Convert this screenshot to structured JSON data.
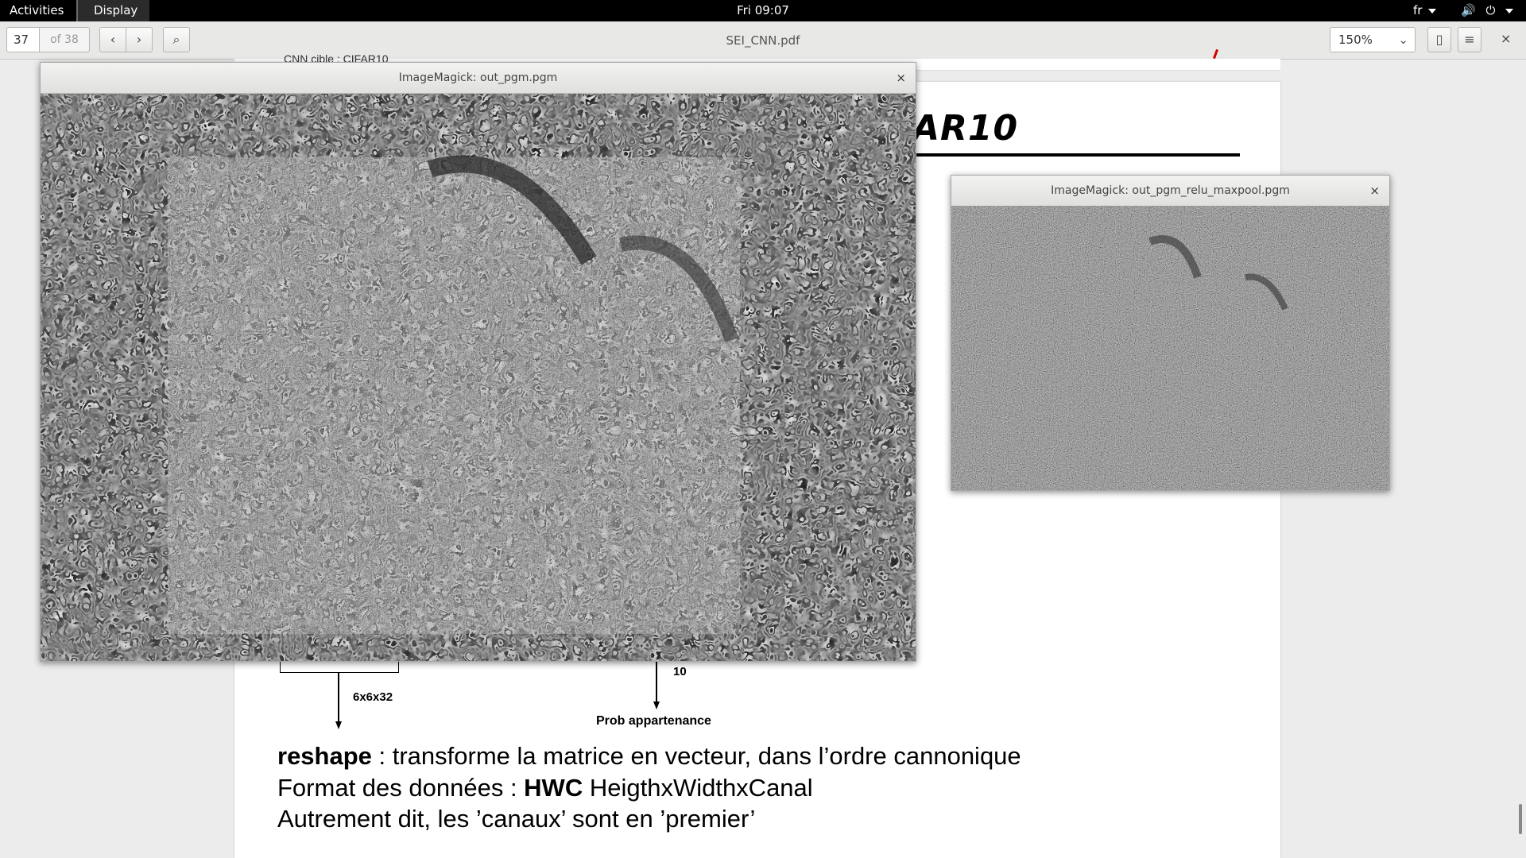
{
  "topbar": {
    "activities": "Activities",
    "display_menu": "Display",
    "clock": "Fri 09:07",
    "language": "fr",
    "icons": [
      "volume-icon",
      "power-icon"
    ]
  },
  "toolbar": {
    "page_number": "37",
    "page_of": "of 38",
    "document_title": "SEI_CNN.pdf",
    "zoom": "150%",
    "icons": [
      "prev-page-icon",
      "next-page-icon",
      "search-icon",
      "thumbnail-icon",
      "hamburger-menu-icon",
      "close-icon"
    ]
  },
  "pdf": {
    "cropped_title": "AR10",
    "top_strip_text": "CNN cible : CIFAR10",
    "diagram_labels": {
      "shape_label": "6x6x32",
      "output_count": "10",
      "output_label": "Prob appartenance"
    },
    "body": {
      "line1_bold": "reshape",
      "line1_rest": " : transforme la matrice en vecteur, dans l’ordre cannonique",
      "line2_start": "Format des données : ",
      "line2_bold": "HWC",
      "line2_rest": " HeigthxWidthxCanal",
      "line3": "Autrement dit, les ’canaux’ sont en ’premier’"
    },
    "accent_color": "#cc0000"
  },
  "windows": [
    {
      "title": "ImageMagick: out_pgm.pgm",
      "close": "×"
    },
    {
      "title": "ImageMagick: out_pgm_relu_maxpool.pgm",
      "close": "×"
    }
  ]
}
